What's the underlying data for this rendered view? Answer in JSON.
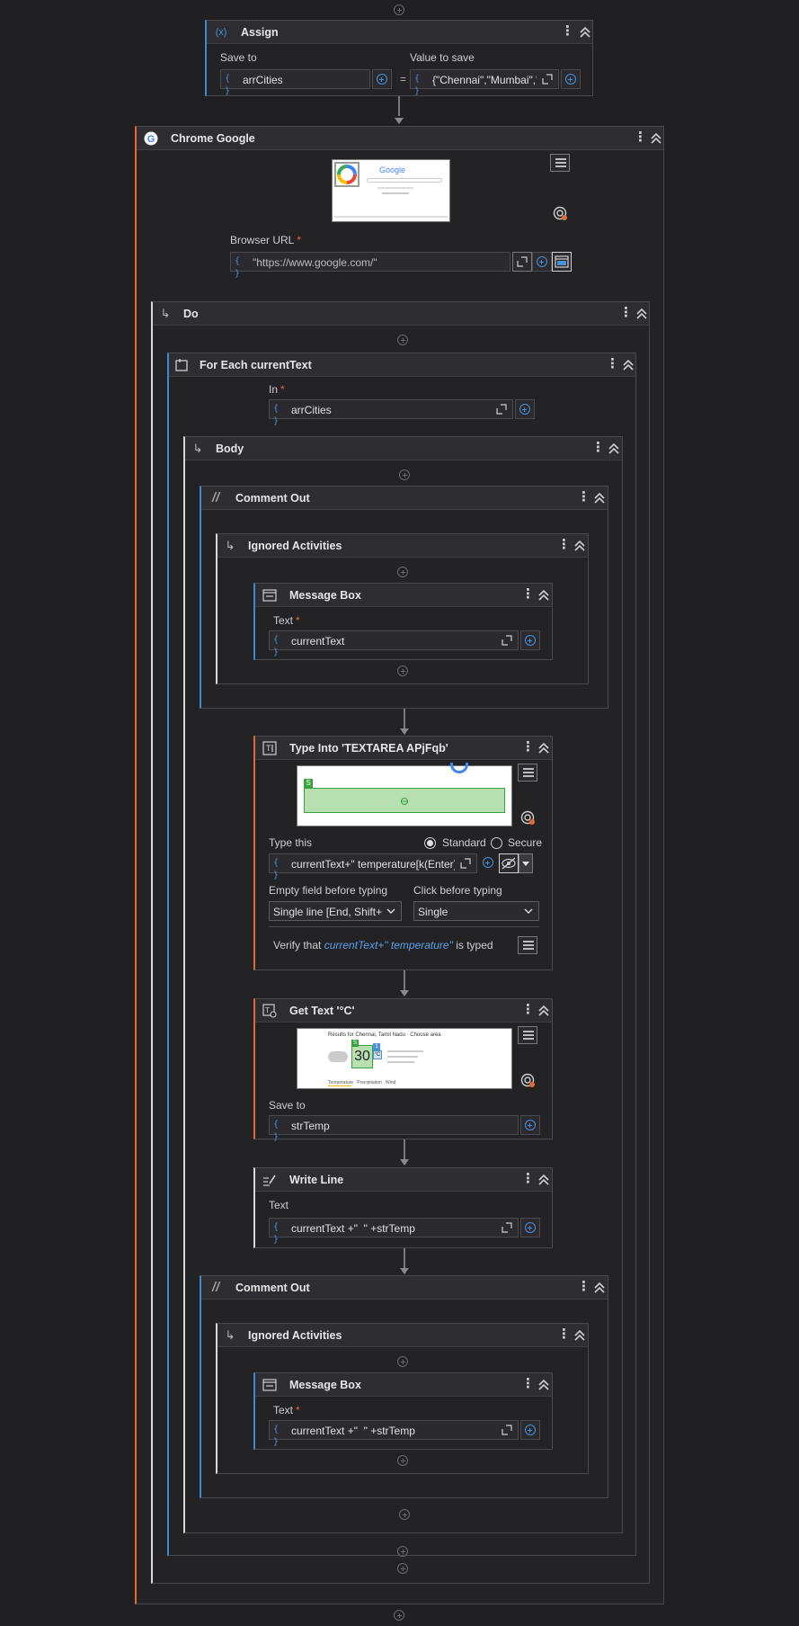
{
  "assign": {
    "title": "Assign",
    "save_to_label": "Save to",
    "save_to_value": "arrCities",
    "equals": "=",
    "value_label": "Value to save",
    "value_value": "{\"Chennai\",\"Mumbai\",\"",
    "icon": "assign-icon"
  },
  "chrome": {
    "title": "Chrome Google",
    "url_label": "Browser URL",
    "required": "*",
    "url_value": "\"https://www.google.com/\"",
    "icon": "chrome-icon",
    "preview_text": "Google"
  },
  "do": {
    "title": "Do"
  },
  "foreach": {
    "title": "For Each currentText",
    "in_label": "In",
    "required": "*",
    "in_value": "arrCities"
  },
  "body": {
    "title": "Body"
  },
  "comment1": {
    "title": "Comment Out",
    "ignored_title": "Ignored Activities",
    "msgbox_title": "Message Box",
    "text_label": "Text",
    "required": "*",
    "text_value": "currentText"
  },
  "typeinto": {
    "title": "Type Into 'TEXTAREA APjFqb'",
    "type_this_label": "Type this",
    "standard_label": "Standard",
    "secure_label": "Secure",
    "type_value": "currentText+\" temperature[k(Enter)]\"",
    "empty_field_label": "Empty field before typing",
    "empty_field_value": "Single line [End, Shift+Home, Delete]",
    "click_before_label": "Click before typing",
    "click_before_value": "Single",
    "verify_prefix": "Verify that",
    "verify_expr": "currentText+\" temperature\"",
    "verify_suffix": "is typed",
    "badge": "S"
  },
  "gettext": {
    "title": "Get Text '°C'",
    "save_to_label": "Save to",
    "save_to_value": "strTemp",
    "preview_heading": "Results for Chennai, Tamil Nadu · Choose area",
    "preview_temp": "30",
    "preview_unit": "°C",
    "preview_links": "Temperature   Precipitation   Wind",
    "badge1": "S",
    "badge2": "1"
  },
  "writeline": {
    "title": "Write Line",
    "text_label": "Text",
    "text_value": "currentText +\"  \" +strTemp"
  },
  "comment2": {
    "title": "Comment Out",
    "ignored_title": "Ignored Activities",
    "msgbox_title": "Message Box",
    "text_label": "Text",
    "required": "*",
    "text_value": "currentText +\"  \" +strTemp"
  },
  "colors": {
    "background": "#202023",
    "accent_blue": "#3a8ad6",
    "accent_orange": "#e0693a",
    "green_highlight": "#b7dfb0"
  }
}
